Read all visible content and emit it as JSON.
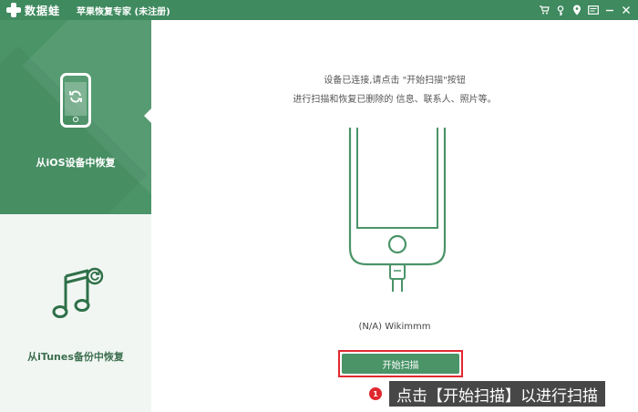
{
  "titlebar": {
    "logo_text": "数据蛙",
    "app_title": "苹果恢复专家 (未注册)",
    "icons": [
      "cart-icon",
      "key-icon",
      "pin-icon",
      "feedback-icon",
      "minimize-icon",
      "close-icon"
    ]
  },
  "sidebar": {
    "items": [
      {
        "label": "从iOS设备中恢复",
        "icon": "phone-recover-icon",
        "active": true
      },
      {
        "label": "从iTunes备份中恢复",
        "icon": "itunes-music-icon",
        "active": false
      }
    ]
  },
  "main": {
    "instruction_line1": "设备已连接,请点击 \"开始扫描\"按钮",
    "instruction_line2": "进行扫描和恢复已删除的 信息、联系人、照片等。",
    "device_name": "(N/A) Wikimmm",
    "scan_button_label": "开始扫描"
  },
  "callout": {
    "badge": "1",
    "text": "点击【开始扫描】以进行扫描"
  },
  "colors": {
    "brand_green": "#3f8a5f",
    "active_green": "#4a9468",
    "highlight_red": "#e0292f"
  }
}
